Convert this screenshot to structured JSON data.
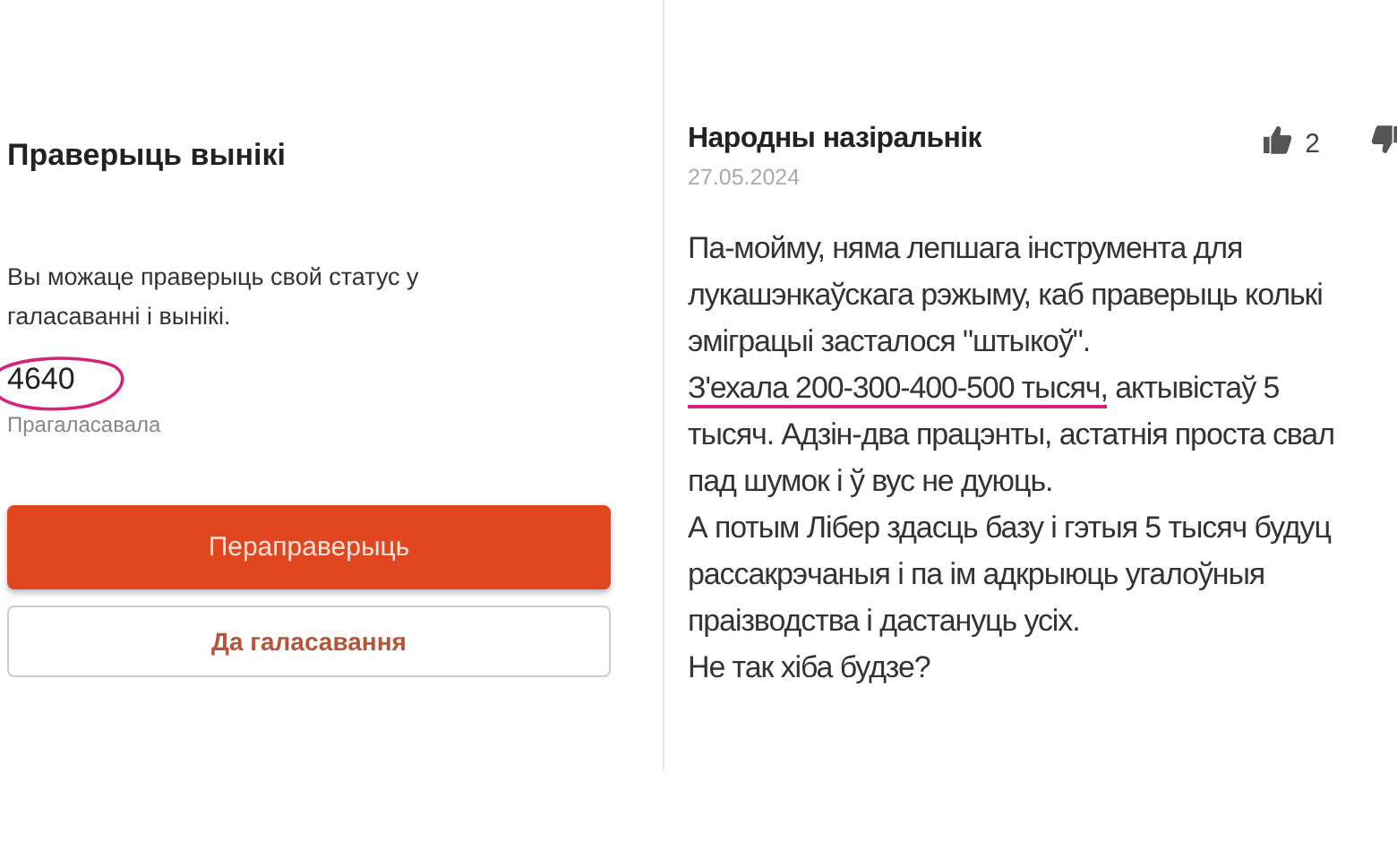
{
  "results_panel": {
    "title": "Праверыць вынікі",
    "description": "Вы можаце праверыць свой статус у галасаванні і вынікі.",
    "status_code": {
      "value": "4640",
      "circled": true
    },
    "status_label": "Прагаласавала",
    "buttons": [
      {
        "label": "Пераправерыць",
        "kind": "primary"
      },
      {
        "label": "Да галасавання",
        "kind": "secondary"
      }
    ]
  },
  "comment": {
    "author": "Народны назіральнік",
    "date": "27.05.2024",
    "likes": "2",
    "lines": [
      {
        "parts": [
          {
            "text": "Па-мойму, няма лепшага інструмента для",
            "underlined": false
          }
        ]
      },
      {
        "parts": [
          {
            "text": "лукашэнкаўскага рэжыму, каб праверыць колькі",
            "underlined": false
          }
        ]
      },
      {
        "parts": [
          {
            "text": "эміграцыі засталося \"штыкоў\".",
            "underlined": false
          }
        ]
      },
      {
        "parts": [
          {
            "text": "З'ехала 200-300-400-500 тысяч,",
            "underlined": true
          },
          {
            "text": " актывістаў 5",
            "underlined": false
          }
        ]
      },
      {
        "parts": [
          {
            "text": "тысяч. Адзін-два працэнты, астатнія проста свал",
            "underlined": false
          }
        ]
      },
      {
        "parts": [
          {
            "text": "пад шумок і ў вус не дуюць.",
            "underlined": false
          }
        ]
      },
      {
        "parts": [
          {
            "text": "А потым Лібер здасць базу і гэтыя 5 тысяч будуц",
            "underlined": false
          }
        ]
      },
      {
        "parts": [
          {
            "text": "рассакрэчаныя і па ім адкрыюць угалоўныя",
            "underlined": false
          }
        ]
      },
      {
        "parts": [
          {
            "text": "праізводства і дастануць усіх.",
            "underlined": false
          }
        ]
      },
      {
        "parts": [
          {
            "text": "Не так хіба будзе?",
            "underlined": false
          }
        ]
      }
    ]
  }
}
